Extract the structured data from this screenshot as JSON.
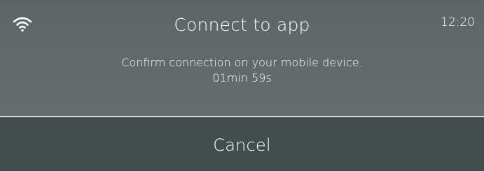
{
  "header": {
    "title": "Connect to app",
    "time": "12:20",
    "status_icon": "wifi-icon"
  },
  "message": {
    "line1": "Confirm connection on your mobile device.",
    "countdown": "01min 59s"
  },
  "actions": {
    "cancel_label": "Cancel"
  },
  "colors": {
    "top_panel": "#626a6b",
    "bottom_panel": "#434d4d",
    "divider": "#d9dddd",
    "text": "#ffffff"
  }
}
